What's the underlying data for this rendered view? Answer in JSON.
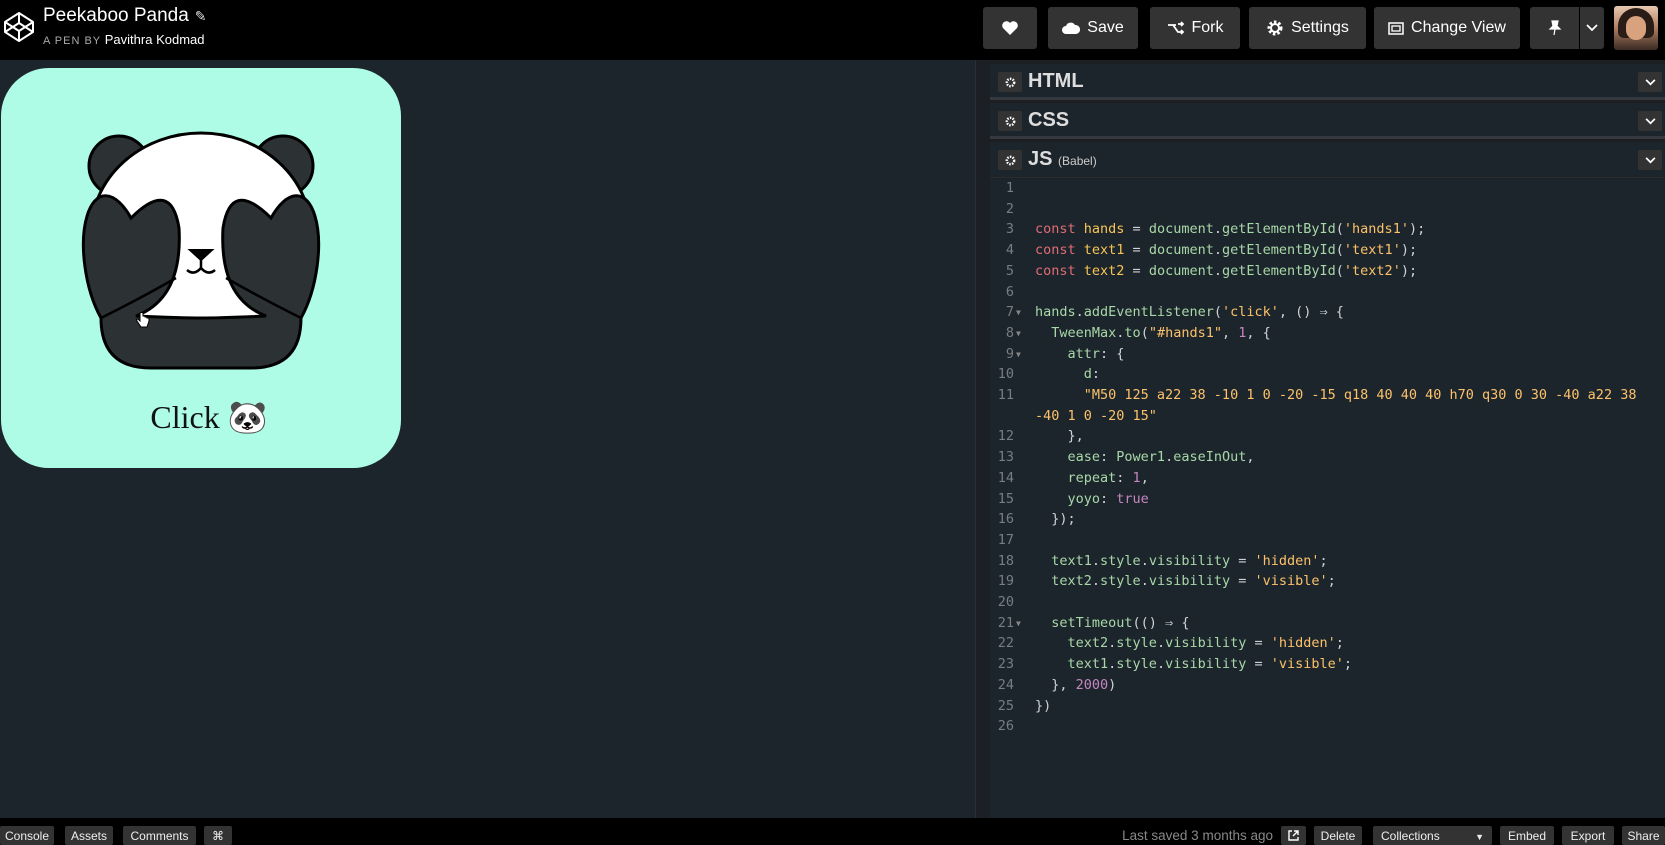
{
  "header": {
    "title": "Peekaboo Panda",
    "byline_prefix": "A PEN BY",
    "author": "Pavithra Kodmad",
    "buttons": {
      "save": "Save",
      "fork": "Fork",
      "settings": "Settings",
      "change_view": "Change View"
    }
  },
  "preview": {
    "click_text": "Click",
    "click_emoji": "🐼"
  },
  "editors": [
    {
      "name": "HTML",
      "sub": ""
    },
    {
      "name": "CSS",
      "sub": ""
    },
    {
      "name": "JS",
      "sub": "(Babel)"
    }
  ],
  "code": {
    "line_numbers": [
      "1",
      "2",
      "3",
      "4",
      "5",
      "6",
      "7",
      "8",
      "9",
      "10",
      "11",
      "",
      "12",
      "13",
      "14",
      "15",
      "16",
      "17",
      "18",
      "19",
      "20",
      "21",
      "22",
      "23",
      "24",
      "25",
      "26"
    ],
    "lines": [
      [],
      [],
      [
        {
          "t": "const ",
          "c": "kw"
        },
        {
          "t": "hands",
          "c": "var"
        },
        {
          "t": " = ",
          "c": "plain"
        },
        {
          "t": "document",
          "c": "fn"
        },
        {
          "t": ".",
          "c": "plain"
        },
        {
          "t": "getElementById",
          "c": "fn"
        },
        {
          "t": "(",
          "c": "plain"
        },
        {
          "t": "'hands1'",
          "c": "str"
        },
        {
          "t": ");",
          "c": "plain"
        }
      ],
      [
        {
          "t": "const ",
          "c": "kw"
        },
        {
          "t": "text1",
          "c": "var"
        },
        {
          "t": " = ",
          "c": "plain"
        },
        {
          "t": "document",
          "c": "fn"
        },
        {
          "t": ".",
          "c": "plain"
        },
        {
          "t": "getElementById",
          "c": "fn"
        },
        {
          "t": "(",
          "c": "plain"
        },
        {
          "t": "'text1'",
          "c": "str"
        },
        {
          "t": ");",
          "c": "plain"
        }
      ],
      [
        {
          "t": "const ",
          "c": "kw"
        },
        {
          "t": "text2",
          "c": "var"
        },
        {
          "t": " = ",
          "c": "plain"
        },
        {
          "t": "document",
          "c": "fn"
        },
        {
          "t": ".",
          "c": "plain"
        },
        {
          "t": "getElementById",
          "c": "fn"
        },
        {
          "t": "(",
          "c": "plain"
        },
        {
          "t": "'text2'",
          "c": "str"
        },
        {
          "t": ");",
          "c": "plain"
        }
      ],
      [],
      [
        {
          "t": "hands",
          "c": "prop"
        },
        {
          "t": ".",
          "c": "plain"
        },
        {
          "t": "addEventListener",
          "c": "fn"
        },
        {
          "t": "(",
          "c": "plain"
        },
        {
          "t": "'click'",
          "c": "str"
        },
        {
          "t": ", () ⇒ {",
          "c": "plain"
        }
      ],
      [
        {
          "t": "  TweenMax",
          "c": "fn"
        },
        {
          "t": ".",
          "c": "plain"
        },
        {
          "t": "to",
          "c": "fn"
        },
        {
          "t": "(",
          "c": "plain"
        },
        {
          "t": "\"#hands1\"",
          "c": "str"
        },
        {
          "t": ", ",
          "c": "plain"
        },
        {
          "t": "1",
          "c": "num"
        },
        {
          "t": ", {",
          "c": "plain"
        }
      ],
      [
        {
          "t": "    attr",
          "c": "prop"
        },
        {
          "t": ": {",
          "c": "plain"
        }
      ],
      [
        {
          "t": "      d",
          "c": "prop"
        },
        {
          "t": ":",
          "c": "plain"
        }
      ],
      [
        {
          "t": "      \"M50 125 a22 38 -10 1 0 -20 -15 q18 40 40 40 h70 q30 0 30 -40 a22 38",
          "c": "str"
        }
      ],
      [
        {
          "t": "-40 1 0 -20 15\"",
          "c": "str"
        }
      ],
      [
        {
          "t": "    },",
          "c": "plain"
        }
      ],
      [
        {
          "t": "    ease",
          "c": "prop"
        },
        {
          "t": ": ",
          "c": "plain"
        },
        {
          "t": "Power1",
          "c": "fn"
        },
        {
          "t": ".",
          "c": "plain"
        },
        {
          "t": "easeInOut",
          "c": "fn"
        },
        {
          "t": ",",
          "c": "plain"
        }
      ],
      [
        {
          "t": "    repeat",
          "c": "prop"
        },
        {
          "t": ": ",
          "c": "plain"
        },
        {
          "t": "1",
          "c": "num"
        },
        {
          "t": ",",
          "c": "plain"
        }
      ],
      [
        {
          "t": "    yoyo",
          "c": "prop"
        },
        {
          "t": ": ",
          "c": "plain"
        },
        {
          "t": "true",
          "c": "num"
        }
      ],
      [
        {
          "t": "  });",
          "c": "plain"
        }
      ],
      [],
      [
        {
          "t": "  text1",
          "c": "prop"
        },
        {
          "t": ".",
          "c": "plain"
        },
        {
          "t": "style",
          "c": "prop"
        },
        {
          "t": ".",
          "c": "plain"
        },
        {
          "t": "visibility",
          "c": "prop"
        },
        {
          "t": " = ",
          "c": "plain"
        },
        {
          "t": "'hidden'",
          "c": "str"
        },
        {
          "t": ";",
          "c": "plain"
        }
      ],
      [
        {
          "t": "  text2",
          "c": "prop"
        },
        {
          "t": ".",
          "c": "plain"
        },
        {
          "t": "style",
          "c": "prop"
        },
        {
          "t": ".",
          "c": "plain"
        },
        {
          "t": "visibility",
          "c": "prop"
        },
        {
          "t": " = ",
          "c": "plain"
        },
        {
          "t": "'visible'",
          "c": "str"
        },
        {
          "t": ";",
          "c": "plain"
        }
      ],
      [],
      [
        {
          "t": "  setTimeout",
          "c": "fn"
        },
        {
          "t": "(() ⇒ {",
          "c": "plain"
        }
      ],
      [
        {
          "t": "    text2",
          "c": "prop"
        },
        {
          "t": ".",
          "c": "plain"
        },
        {
          "t": "style",
          "c": "prop"
        },
        {
          "t": ".",
          "c": "plain"
        },
        {
          "t": "visibility",
          "c": "prop"
        },
        {
          "t": " = ",
          "c": "plain"
        },
        {
          "t": "'hidden'",
          "c": "str"
        },
        {
          "t": ";",
          "c": "plain"
        }
      ],
      [
        {
          "t": "    text1",
          "c": "prop"
        },
        {
          "t": ".",
          "c": "plain"
        },
        {
          "t": "style",
          "c": "prop"
        },
        {
          "t": ".",
          "c": "plain"
        },
        {
          "t": "visibility",
          "c": "prop"
        },
        {
          "t": " = ",
          "c": "plain"
        },
        {
          "t": "'visible'",
          "c": "str"
        },
        {
          "t": ";",
          "c": "plain"
        }
      ],
      [
        {
          "t": "  }, ",
          "c": "plain"
        },
        {
          "t": "2000",
          "c": "num"
        },
        {
          "t": ")",
          "c": "plain"
        }
      ],
      [
        {
          "t": "})",
          "c": "plain"
        }
      ],
      []
    ],
    "fold_lines": [
      "7",
      "8",
      "9",
      "21"
    ]
  },
  "footer": {
    "console": "Console",
    "assets": "Assets",
    "comments": "Comments",
    "cmd": "⌘",
    "last_saved": "Last saved 3 months ago",
    "delete": "Delete",
    "collections": "Collections",
    "embed": "Embed",
    "export": "Export",
    "share": "Share"
  },
  "icons": {
    "logo": "codepen-logo-icon",
    "heart": "heart-icon",
    "save": "cloud-icon",
    "fork": "fork-icon",
    "settings": "gear-icon",
    "change_view": "layout-icon",
    "pin": "pin-icon",
    "caret": "chevron-down-icon"
  }
}
